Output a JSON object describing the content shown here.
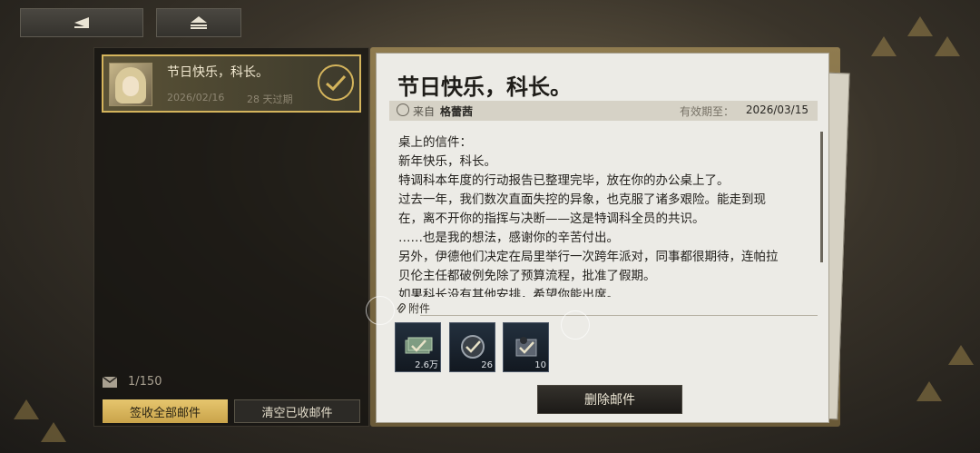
{
  "top_bar": {
    "back_icon": "back-arrow-icon",
    "home_icon": "home-icon"
  },
  "mail_list": {
    "items": [
      {
        "title": "节日快乐，科长。",
        "date": "2026/02/16",
        "expire": "28 天过期",
        "claimed": true
      }
    ],
    "count": "1/150",
    "claim_all_label": "签收全部邮件",
    "clear_claimed_label": "清空已收邮件"
  },
  "letter": {
    "title": "节日快乐，科长。",
    "from_label": "来自",
    "sender": "格蕾茜",
    "expiry_label": "有效期至：",
    "expiry_date": "2026/03/15",
    "body": [
      "桌上的信件：",
      "新年快乐，科长。",
      "特调科本年度的行动报告已整理完毕，放在你的办公桌上了。",
      "过去一年，我们数次直面失控的异象，也克服了诸多艰险。能走到现",
      "在，离不开你的指挥与决断——这是特调科全员的共识。",
      "……也是我的想法，感谢你的辛苦付出。",
      "另外，伊德他们决定在局里举行一次跨年派对，同事都很期待，连帕拉",
      "贝伦主任都破例免除了预算流程，批准了假期。",
      "如果科长没有其他安排，希望你能出席。"
    ],
    "attachments_label": "附件",
    "attachments": [
      {
        "name": "currency-bundle",
        "qty": "2.6万"
      },
      {
        "name": "badge-token",
        "qty": "26"
      },
      {
        "name": "material-box",
        "qty": "10"
      }
    ],
    "delete_label": "删除邮件"
  },
  "colors": {
    "accent": "#d4b45c",
    "card_bg": "#ecebe6",
    "panel_bg": "#14120f"
  }
}
